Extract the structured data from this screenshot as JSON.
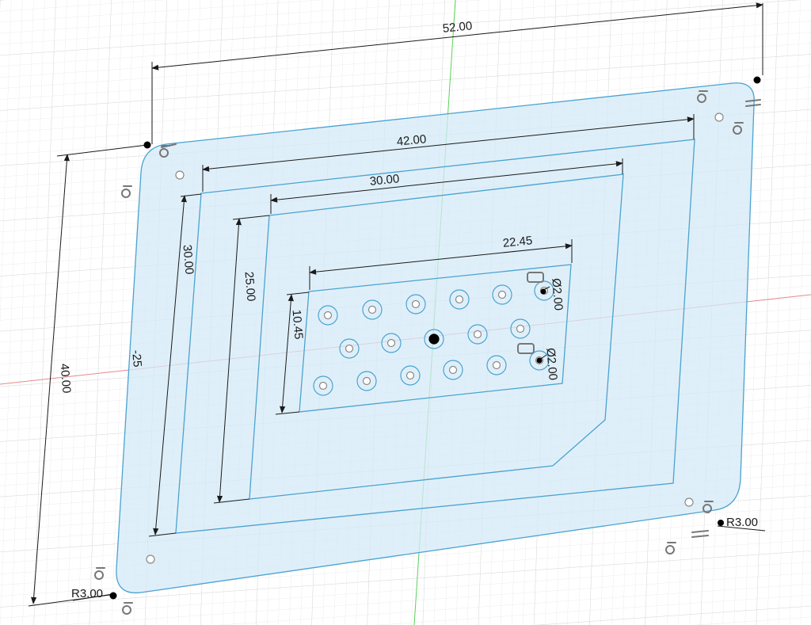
{
  "dimensions": {
    "outer_width": "52.00",
    "frame_width": "42.00",
    "inner_width": "30.00",
    "pattern_width": "22.45",
    "outer_height": "40.00",
    "frame_height": "30.00",
    "inner_height": "25.00",
    "pattern_height": "10.45",
    "offset": "-25",
    "radius_bottom_left": "R3.00",
    "radius_bottom_right": "R3.00",
    "hole_diameter_top": "Ø2.00",
    "hole_diameter_bottom": "Ø2.00"
  },
  "colors": {
    "profile_fill": "#d4eaf7",
    "profile_stroke": "#4aa3d1",
    "x_axis": "#e48a8a",
    "y_axis": "#5bd15b",
    "grid": "#e6e6e6",
    "dimension_line": "#1a1a1a"
  },
  "icons": [
    "coincident-constraint-icon",
    "tangent-constraint-icon",
    "parallel-constraint-icon"
  ]
}
